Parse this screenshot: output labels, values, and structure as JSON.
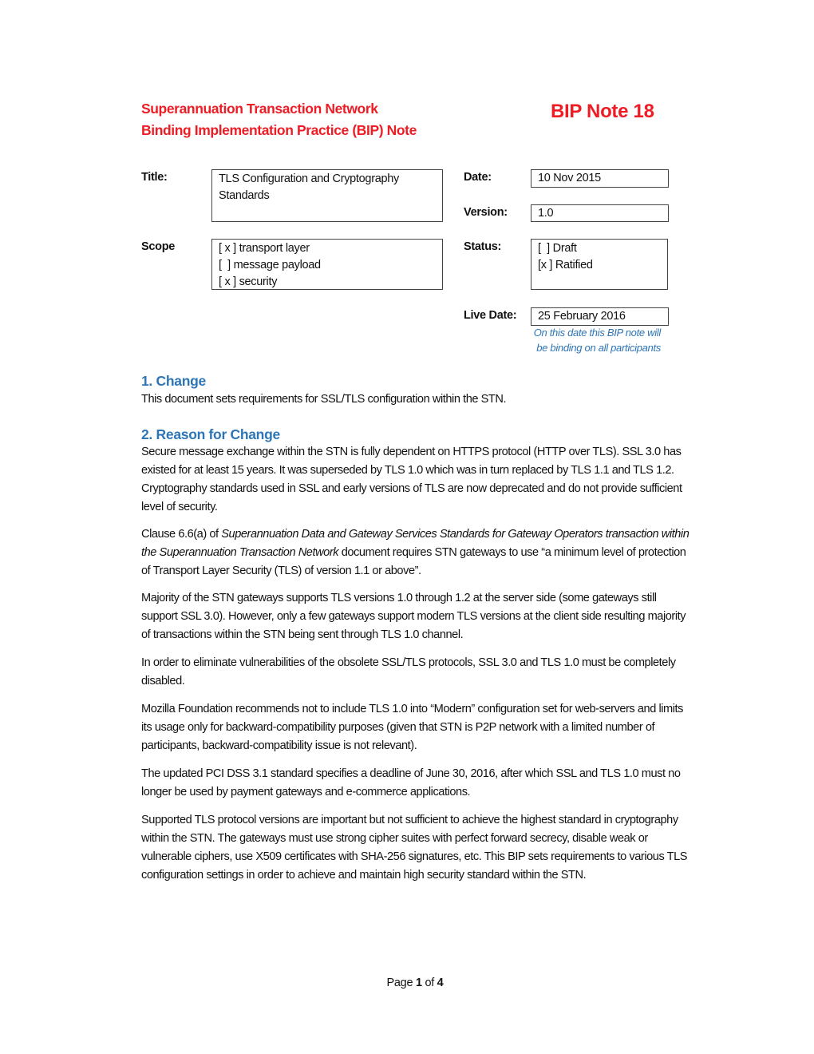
{
  "header": {
    "line1": "Superannuation Transaction Network",
    "line2": "Binding Implementation Practice (BIP) Note",
    "bip_note": "BIP Note 18"
  },
  "fields": {
    "title_label": "Title:",
    "title_value_line1": "TLS Configuration and Cryptography",
    "title_value_line2": "Standards",
    "date_label": "Date:",
    "date_value": "10 Nov 2015",
    "version_label": "Version:",
    "version_value": "1.0",
    "scope_label": "Scope",
    "scope_items": [
      "[ x ] transport layer",
      "[  ] message payload",
      "[ x ] security"
    ],
    "status_label": "Status:",
    "status_items": [
      "[  ] Draft",
      "[x ] Ratified"
    ],
    "live_date_label": "Live Date:",
    "live_date_value": "25 February 2016",
    "live_date_note_line1": "On this date this BIP note will",
    "live_date_note_line2": "be binding on all participants"
  },
  "sections": {
    "change_heading": "1. Change",
    "change_body": "This document sets requirements for SSL/TLS configuration within the STN.",
    "reason_heading": "2. Reason for Change",
    "reason_p1": "Secure message exchange within the STN is fully dependent on HTTPS protocol (HTTP over TLS). SSL 3.0 has existed for at least 15 years. It was superseded by TLS 1.0 which was in turn replaced by TLS 1.1 and TLS 1.2. Cryptography standards used in SSL and early versions of TLS are now deprecated and do not provide sufficient level of security.",
    "reason_p2_prefix": "Clause 6.6(a) of ",
    "reason_p2_italic": "Superannuation Data and Gateway Services Standards for Gateway Operators transaction within the Superannuation Transaction Network",
    "reason_p2_suffix": " document requires STN gateways to use “a minimum level of protection of Transport Layer Security (TLS) of version 1.1 or above”.",
    "reason_p3": "Majority of the STN gateways supports TLS versions 1.0 through 1.2 at the server side (some gateways still support SSL 3.0). However, only a few gateways support modern TLS versions at the client side resulting majority of transactions within the STN being sent through TLS 1.0 channel.",
    "reason_p4": "In order to eliminate vulnerabilities of the obsolete SSL/TLS protocols, SSL 3.0 and TLS 1.0 must be completely disabled.",
    "reason_p5": "Mozilla Foundation recommends not to include TLS 1.0 into “Modern” configuration set for web-servers and limits its usage only for backward-compatibility purposes (given that STN is P2P network with a limited number of participants, backward-compatibility issue is not relevant).",
    "reason_p6": "The updated PCI DSS 3.1 standard specifies a deadline of June 30, 2016, after which SSL and TLS 1.0 must no longer be used by payment gateways and e-commerce applications.",
    "reason_p7": "Supported TLS protocol versions are important but not sufficient to achieve the highest standard in cryptography within the STN. The gateways must use strong cipher suites with perfect forward secrecy, disable weak or vulnerable ciphers, use X509 certificates with SHA-256 signatures, etc. This BIP sets requirements to various TLS configuration settings in order to achieve and maintain high security standard within the STN."
  },
  "footer": {
    "page_word": "Page ",
    "current_page": "1",
    "of_word": " of ",
    "total_pages": "4"
  },
  "colors": {
    "header_red": "#ee1c24",
    "heading_blue": "#2e75b6"
  }
}
